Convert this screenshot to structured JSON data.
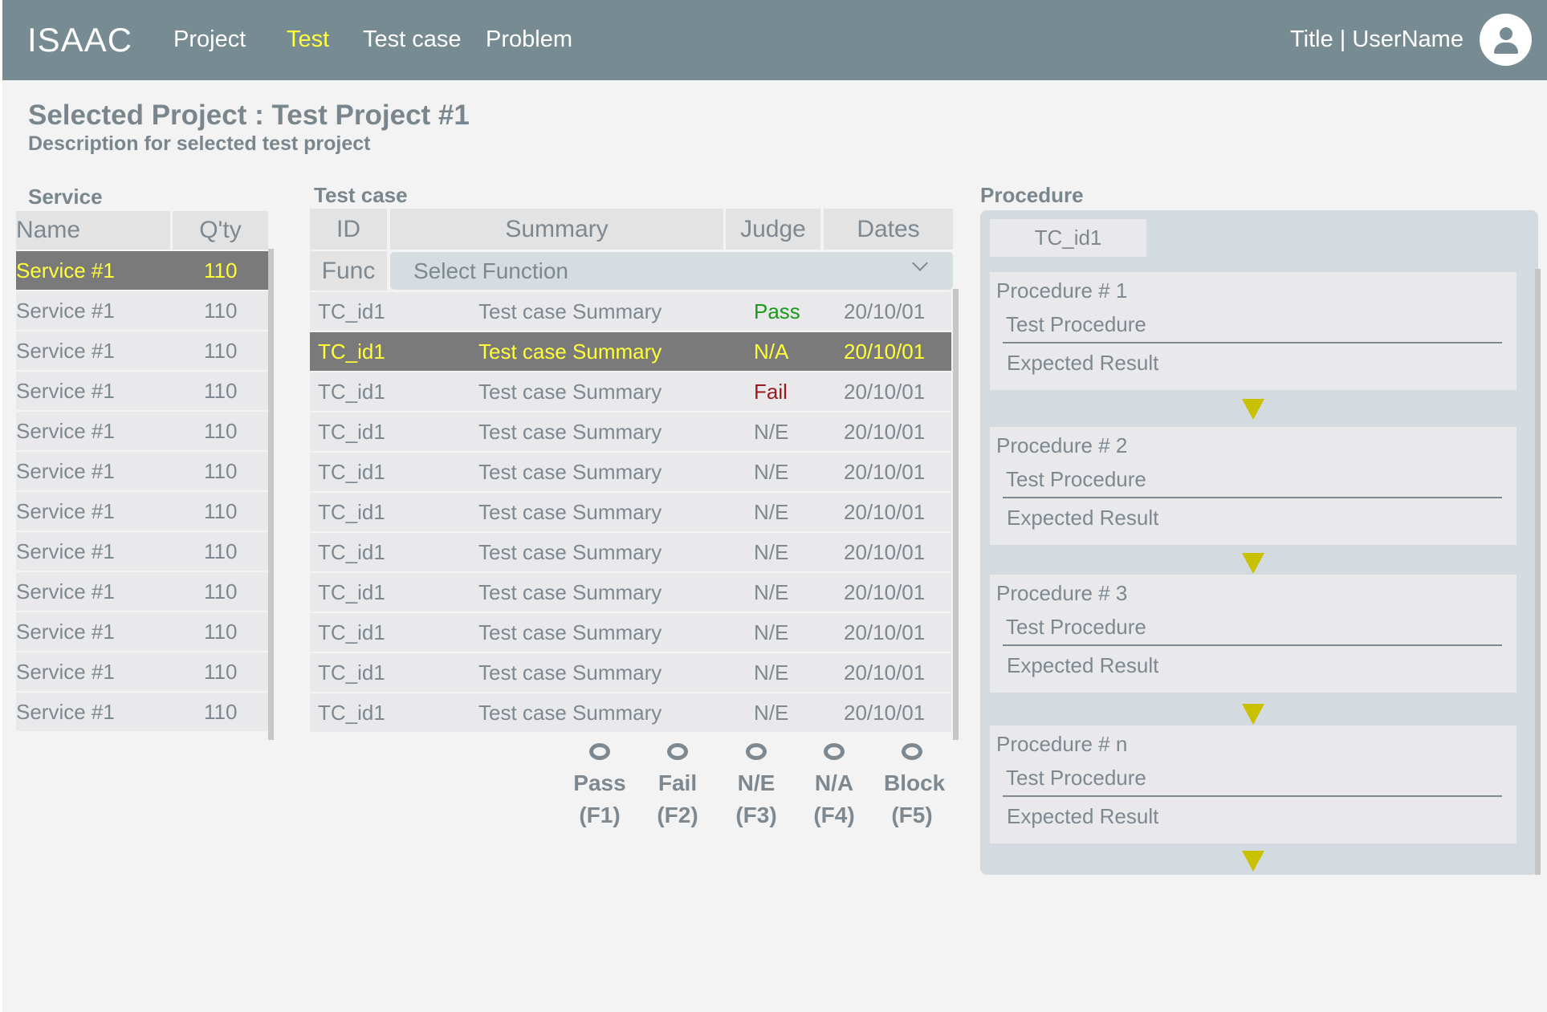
{
  "app": {
    "logo": "ISAAC"
  },
  "nav": {
    "items": [
      "Project",
      "Test",
      "Test case",
      "Problem"
    ],
    "active": "Test"
  },
  "user": {
    "title_username": "Title | UserName"
  },
  "project": {
    "title": "Selected Project : Test Project #1",
    "description": "Description  for selected test project"
  },
  "service": {
    "label": "Service",
    "headers": {
      "name": "Name",
      "qty": "Q'ty"
    },
    "rows": [
      {
        "name": "Service #1",
        "qty": "110",
        "selected": true
      },
      {
        "name": "Service #1",
        "qty": "110"
      },
      {
        "name": "Service #1",
        "qty": "110"
      },
      {
        "name": "Service #1",
        "qty": "110"
      },
      {
        "name": "Service #1",
        "qty": "110"
      },
      {
        "name": "Service #1",
        "qty": "110"
      },
      {
        "name": "Service #1",
        "qty": "110"
      },
      {
        "name": "Service #1",
        "qty": "110"
      },
      {
        "name": "Service #1",
        "qty": "110"
      },
      {
        "name": "Service #1",
        "qty": "110"
      },
      {
        "name": "Service #1",
        "qty": "110"
      },
      {
        "name": "Service #1",
        "qty": "110"
      }
    ]
  },
  "testcase": {
    "label": "Test case",
    "headers": {
      "id": "ID",
      "summary": "Summary",
      "judge": "Judge",
      "dates": "Dates"
    },
    "func_label": "Func",
    "func_placeholder": "Select Function",
    "rows": [
      {
        "id": "TC_id1",
        "summary": "Test case Summary",
        "judge": "Pass",
        "date": "20/10/01"
      },
      {
        "id": "TC_id1",
        "summary": "Test case Summary",
        "judge": "N/A",
        "date": "20/10/01",
        "selected": true
      },
      {
        "id": "TC_id1",
        "summary": "Test case Summary",
        "judge": "Fail",
        "date": "20/10/01"
      },
      {
        "id": "TC_id1",
        "summary": "Test case Summary",
        "judge": "N/E",
        "date": "20/10/01"
      },
      {
        "id": "TC_id1",
        "summary": "Test case Summary",
        "judge": "N/E",
        "date": "20/10/01"
      },
      {
        "id": "TC_id1",
        "summary": "Test case Summary",
        "judge": "N/E",
        "date": "20/10/01"
      },
      {
        "id": "TC_id1",
        "summary": "Test case Summary",
        "judge": "N/E",
        "date": "20/10/01"
      },
      {
        "id": "TC_id1",
        "summary": "Test case Summary",
        "judge": "N/E",
        "date": "20/10/01"
      },
      {
        "id": "TC_id1",
        "summary": "Test case Summary",
        "judge": "N/E",
        "date": "20/10/01"
      },
      {
        "id": "TC_id1",
        "summary": "Test case Summary",
        "judge": "N/E",
        "date": "20/10/01"
      },
      {
        "id": "TC_id1",
        "summary": "Test case Summary",
        "judge": "N/E",
        "date": "20/10/01"
      }
    ],
    "judge_buttons": [
      {
        "label": "Pass",
        "key": "(F1)"
      },
      {
        "label": "Fail",
        "key": "(F2)"
      },
      {
        "label": "N/E",
        "key": "(F3)"
      },
      {
        "label": "N/A",
        "key": "(F4)"
      },
      {
        "label": "Block",
        "key": "(F5)"
      }
    ]
  },
  "procedure": {
    "label": "Procedure",
    "tab": "TC_id1",
    "cards": [
      {
        "title": "Procedure # 1",
        "test": "Test Procedure",
        "expected": "Expected Result"
      },
      {
        "title": "Procedure # 2",
        "test": "Test Procedure",
        "expected": "Expected Result"
      },
      {
        "title": "Procedure # 3",
        "test": "Test Procedure",
        "expected": "Expected Result"
      },
      {
        "title": "Procedure # n",
        "test": "Test Procedure",
        "expected": "Expected Result"
      }
    ]
  },
  "colors": {
    "topbar": "#768b92",
    "accent_yellow": "#ffff3c",
    "arrow": "#c9c100",
    "pass": "#1a9a1a",
    "fail": "#9b1b1b",
    "selected_row": "#7a7a7a"
  }
}
